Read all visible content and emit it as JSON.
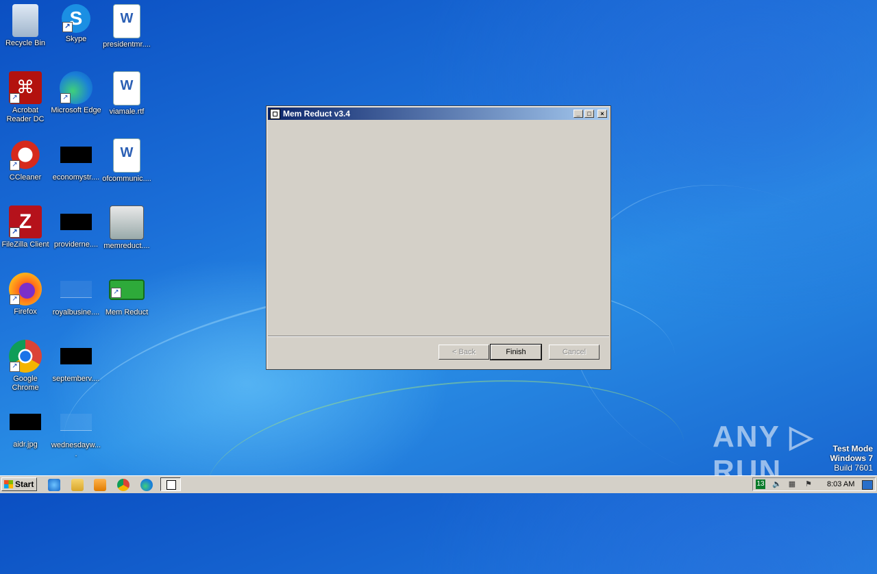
{
  "desktop": {
    "icons": [
      {
        "label": "Recycle Bin",
        "icon": "recycle-bin-icon"
      },
      {
        "label": "Skype",
        "icon": "skype-icon"
      },
      {
        "label": "presidentmr....",
        "icon": "word-document-icon"
      },
      {
        "label": "Acrobat Reader DC",
        "icon": "acrobat-icon"
      },
      {
        "label": "Microsoft Edge",
        "icon": "edge-icon"
      },
      {
        "label": "viamale.rtf",
        "icon": "word-document-icon"
      },
      {
        "label": "CCleaner",
        "icon": "ccleaner-icon"
      },
      {
        "label": "economystr....",
        "icon": "black-thumbnail-icon"
      },
      {
        "label": "ofcommunic....",
        "icon": "word-document-icon"
      },
      {
        "label": "FileZilla Client",
        "icon": "filezilla-icon"
      },
      {
        "label": "providerne....",
        "icon": "black-thumbnail-icon"
      },
      {
        "label": "memreduct....",
        "icon": "installer-icon"
      },
      {
        "label": "Firefox",
        "icon": "firefox-icon"
      },
      {
        "label": "royalbusine....",
        "icon": "blank-file-icon"
      },
      {
        "label": "Mem Reduct",
        "icon": "memreduct-icon"
      },
      {
        "label": "Google Chrome",
        "icon": "chrome-icon"
      },
      {
        "label": "septemberv....",
        "icon": "black-thumbnail-icon"
      },
      {
        "label": "aidr.jpg",
        "icon": "black-thumbnail-icon"
      },
      {
        "label": "wednesdayw....",
        "icon": "blank-file-icon"
      }
    ]
  },
  "dialog": {
    "title": "Mem Reduct v3.4",
    "minimize_label": "_",
    "maximize_label": "□",
    "close_label": "×",
    "back_label": "< Back",
    "finish_label": "Finish",
    "cancel_label": "Cancel"
  },
  "watermark": {
    "text": "ANY ▷ RUN",
    "test_mode": "Test Mode",
    "os": "Windows 7",
    "build": "Build 7601"
  },
  "taskbar": {
    "start_label": "Start",
    "tray_badge": "13",
    "clock": "8:03 AM"
  },
  "colors": {
    "titlebar_start": "#0a246a",
    "titlebar_end": "#a6caf0",
    "dialog_face": "#d4d0c8"
  }
}
